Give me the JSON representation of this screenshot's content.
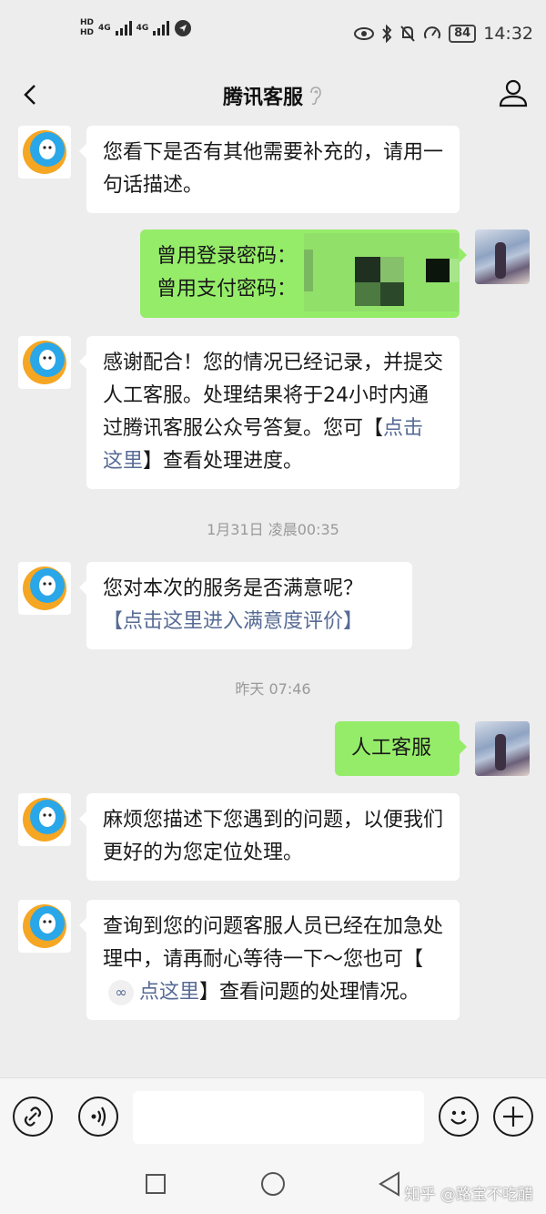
{
  "status_bar": {
    "hd1": "HD",
    "hd2": "HD",
    "net1": "4G",
    "net2": "4G",
    "battery": "84",
    "time": "14:32",
    "icons": [
      "eye-icon",
      "bluetooth-icon",
      "mute-bell-icon",
      "speed-icon"
    ]
  },
  "header": {
    "back_icon": "chevron-left-icon",
    "title": "腾讯客服",
    "ear_icon": "ear-icon",
    "profile_icon": "person-icon"
  },
  "messages": [
    {
      "from": "bot",
      "text": "您看下是否有其他需要补充的，请用一句话描述。"
    },
    {
      "from": "user",
      "lines": [
        "曾用登录密码：",
        "曾用支付密码："
      ]
    },
    {
      "from": "bot",
      "prefix": "感谢配合！您的情况已经记录，并提交人工客服。处理结果将于24小时内通过腾讯客服公众号答复。您可【",
      "link": "点击这里",
      "suffix": "】查看处理进度。"
    },
    {
      "from": "bot",
      "text": "您对本次的服务是否满意呢？",
      "link": "【点击这里进入满意度评价】"
    },
    {
      "from": "user",
      "text": "人工客服"
    },
    {
      "from": "bot",
      "text": "麻烦您描述下您遇到的问题，以便我们更好的为您定位处理。"
    },
    {
      "from": "bot",
      "prefix": "查询到您的问题客服人员已经在加急处理中，请再耐心等待一下～您也可【",
      "link": "点这里",
      "suffix": "】查看问题的处理情况。"
    }
  ],
  "timestamps": [
    "1月31日 凌晨00:35",
    "昨天 07:46"
  ],
  "input_bar": {
    "icons": [
      "link-icon",
      "voice-icon",
      "emoji-icon",
      "plus-icon"
    ]
  },
  "nav_bar": {
    "icons": [
      "square-icon",
      "circle-icon",
      "triangle-back-icon"
    ]
  },
  "watermark": "知乎 @路宝不吃醋",
  "colors": {
    "background": "#ededed",
    "bubble_user": "#95ec69",
    "bubble_bot": "#ffffff",
    "link": "#576b95"
  }
}
